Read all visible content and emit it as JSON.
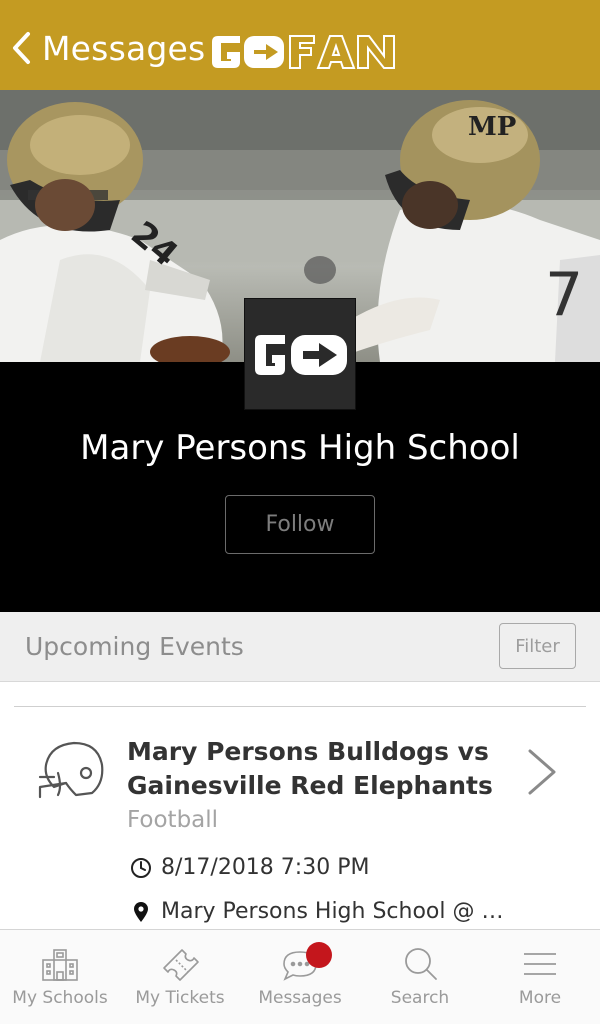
{
  "topbar": {
    "back_label": "Messages",
    "logo_text": "GOFAN",
    "color": "#c49b22"
  },
  "team": {
    "name": "Mary Persons High School",
    "follow_label": "Follow",
    "badge_text": "GO"
  },
  "upcoming": {
    "title": "Upcoming Events",
    "filter_label": "Filter"
  },
  "event": {
    "icon": "football-helmet-icon",
    "title": "Mary Persons Bulldogs vs Gainesville Red Elephants",
    "sport": "Football",
    "datetime": "8/17/2018 7:30 PM",
    "location": "Mary Persons High School @ …"
  },
  "tabs": [
    {
      "label": "My Schools",
      "icon": "school-icon"
    },
    {
      "label": "My Tickets",
      "icon": "ticket-icon"
    },
    {
      "label": "Messages",
      "icon": "chat-bubble-icon"
    },
    {
      "label": "Search",
      "icon": "search-icon"
    },
    {
      "label": "More",
      "icon": "menu-icon"
    }
  ],
  "colors": {
    "accent_gold": "#c49b22",
    "notification_red": "#c4161c",
    "section_black": "#000000"
  }
}
